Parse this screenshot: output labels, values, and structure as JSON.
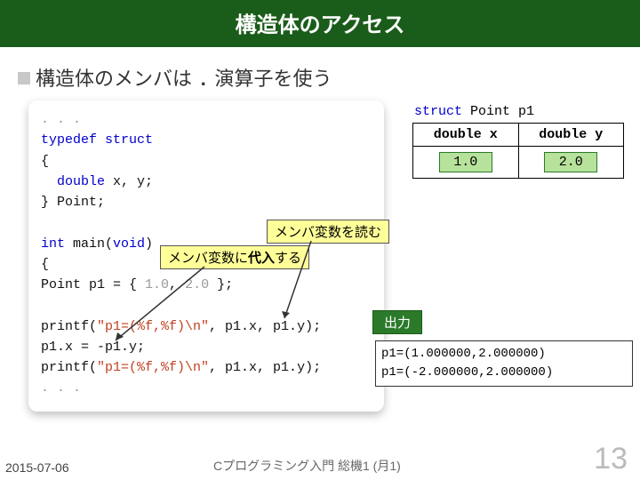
{
  "header": {
    "title": "構造体のアクセス"
  },
  "subtitle": {
    "prefix": "構造体のメンバは ",
    "dot": ".",
    "suffix": " 演算子を使う"
  },
  "code": {
    "ellipsis": ". . .",
    "typedef_kw": "typedef struct",
    "lbrace": "{",
    "fields_kw": "double",
    "fields_rest": " x, y;",
    "rbrace_name": "} Point;",
    "main_kw": "int",
    "main_rest": " main(",
    "main_void_kw": "void",
    "main_close": ")",
    "main_lbrace": "{",
    "decl_pre": "  Point p1 = { ",
    "decl_v1": "1.0",
    "decl_sep": ", ",
    "decl_v2": "2.0",
    "decl_post": " };",
    "printf1_pre": "  printf(",
    "printf1_str": "\"p1=(%f,%f)\\n\"",
    "printf1_args": ", p1.x, p1.y);",
    "assign_line": "  p1.x = -p1.y;",
    "printf2_pre": "  printf(",
    "printf2_str": "\"p1=(%f,%f)\\n\"",
    "printf2_args": ", p1.x, p1.y);",
    "trailing": "  . . ."
  },
  "struct_table": {
    "caption_kw": "struct",
    "caption_rest": " Point p1",
    "col1": "double x",
    "col2": "double y",
    "val1": "1.0",
    "val2": "2.0"
  },
  "annot": {
    "read": "メンバ変数を読む",
    "assign_pre": "メンバ変数に",
    "assign_bold": "代入",
    "assign_post": "する"
  },
  "output": {
    "label": "出力",
    "line1": "p1=(1.000000,2.000000)",
    "line2": "p1=(-2.000000,2.000000)"
  },
  "footer": {
    "date": "2015-07-06",
    "course": "Cプログラミング入門 総機1 (月1)",
    "page": "13"
  }
}
